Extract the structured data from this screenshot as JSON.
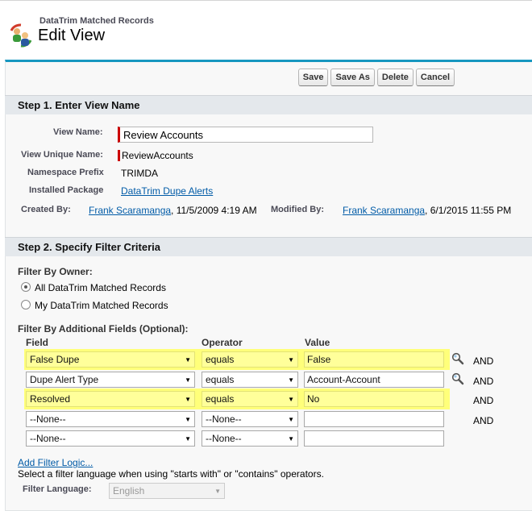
{
  "header": {
    "app_name": "DataTrim Matched Records",
    "title": "Edit View"
  },
  "toolbar": {
    "save": "Save",
    "save_as": "Save As",
    "delete": "Delete",
    "cancel": "Cancel"
  },
  "step1": {
    "title": "Step 1. Enter View Name",
    "view_name_label": "View Name:",
    "view_name_value": "Review Accounts",
    "unique_label": "View Unique Name:",
    "unique_value": "ReviewAccounts",
    "namespace_label": "Namespace Prefix",
    "namespace_value": "TRIMDA",
    "package_label": "Installed Package",
    "package_value": "DataTrim Dupe Alerts",
    "created_label": "Created By:",
    "created_user": "Frank Scaramanga",
    "created_date": ", 11/5/2009 4:19 AM",
    "modified_label": "Modified By:",
    "modified_user": "Frank Scaramanga",
    "modified_date": ", 6/1/2015 11:55 PM"
  },
  "step2": {
    "title": "Step 2. Specify Filter Criteria",
    "owner_label": "Filter By Owner:",
    "owner_all": "All DataTrim Matched Records",
    "owner_my": "My DataTrim Matched Records",
    "owner_selected": "all",
    "additional_label": "Filter By Additional Fields (Optional):",
    "col_field": "Field",
    "col_operator": "Operator",
    "col_value": "Value",
    "rows": [
      {
        "field": "False Dupe",
        "operator": "equals",
        "value": "False",
        "join": "AND",
        "highlighted": true,
        "lookup": true
      },
      {
        "field": "Dupe Alert Type",
        "operator": "equals",
        "value": "Account-Account",
        "join": "AND",
        "highlighted": false,
        "lookup": true
      },
      {
        "field": "Resolved",
        "operator": "equals",
        "value": "No",
        "join": "AND",
        "highlighted": true,
        "lookup": false
      },
      {
        "field": "--None--",
        "operator": "--None--",
        "value": "",
        "join": "AND",
        "highlighted": false,
        "lookup": false
      },
      {
        "field": "--None--",
        "operator": "--None--",
        "value": "",
        "join": "",
        "highlighted": false,
        "lookup": false
      }
    ],
    "add_logic": "Add Filter Logic...",
    "hint": "Select a filter language when using \"starts with\" or \"contains\" operators.",
    "language_label": "Filter Language:",
    "language_value": "English"
  },
  "colors": {
    "accent": "#1797c0",
    "highlight": "#ffff7a",
    "link": "#015ba7",
    "required": "#cc0000"
  }
}
